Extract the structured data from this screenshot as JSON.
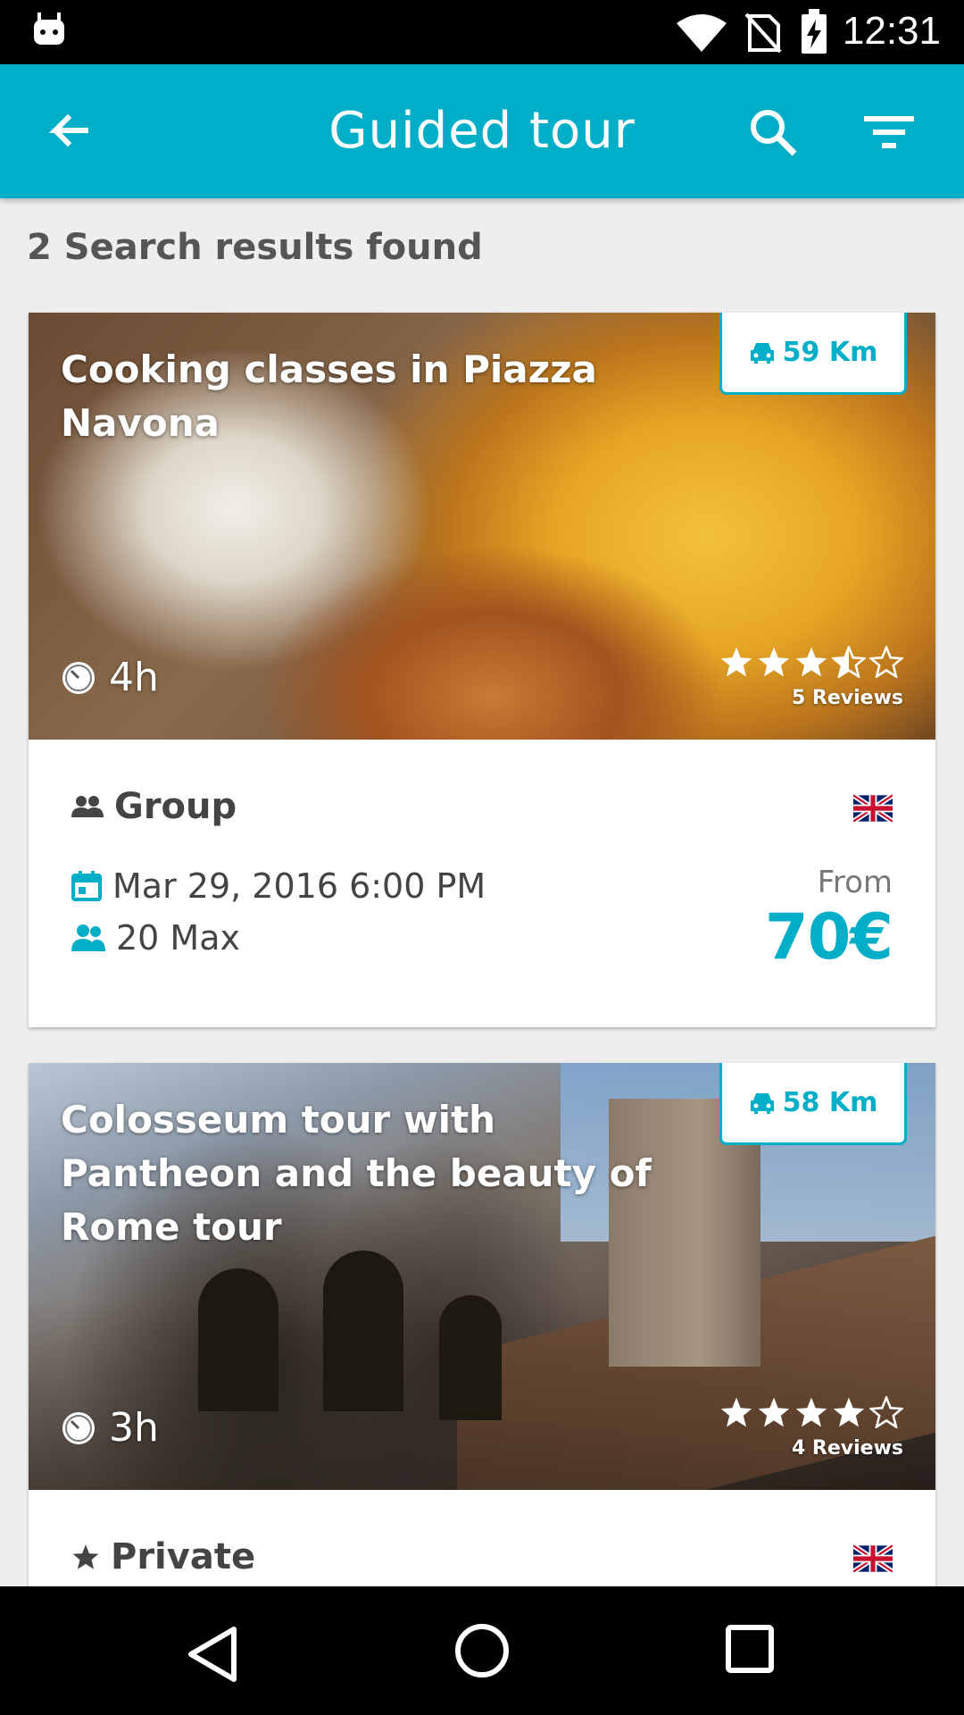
{
  "status_bar": {
    "time": "12:31",
    "icons": [
      "android-icon",
      "wifi-icon",
      "no-sim-icon",
      "battery-charging-icon"
    ]
  },
  "app_bar": {
    "title": "Guided tour",
    "icons": [
      "back-arrow-icon",
      "search-icon",
      "filter-icon"
    ]
  },
  "results": {
    "count_text": "2 Search results found"
  },
  "tours": [
    {
      "title": "Cooking classes in Piazza Navona",
      "distance": "59 Km",
      "duration": "4h",
      "rating": 3.5,
      "reviews": "5 Reviews",
      "type": "Group",
      "type_icon": "group-icon",
      "language_flag": "uk-flag-icon",
      "date": "Mar 29, 2016 6:00 PM",
      "max": "20 Max",
      "from_label": "From",
      "price": "70€"
    },
    {
      "title": "Colosseum tour with Pantheon and the beauty of Rome tour",
      "distance": "58 Km",
      "duration": "3h",
      "rating": 4,
      "reviews": "4 Reviews",
      "type": "Private",
      "type_icon": "star-icon",
      "language_flag": "uk-flag-icon"
    }
  ],
  "nav_bar": {
    "icons": [
      "nav-back-icon",
      "nav-home-icon",
      "nav-recents-icon"
    ]
  },
  "colors": {
    "accent": "#00aec7",
    "background": "#eeeeee",
    "text_dark": "#444444"
  }
}
